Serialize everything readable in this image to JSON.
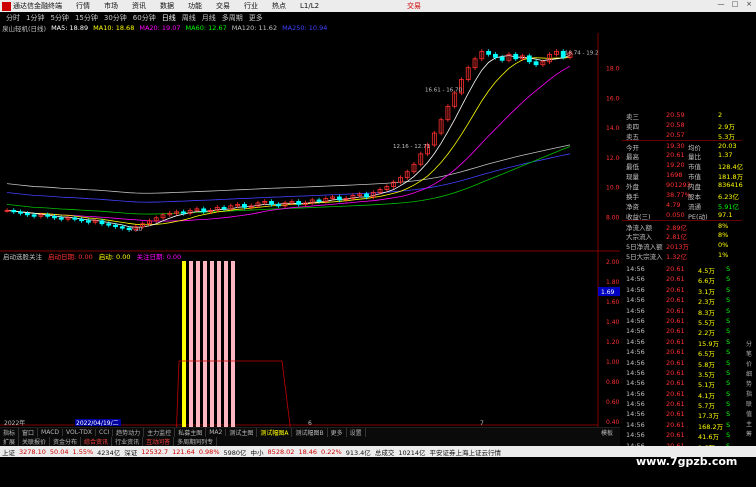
{
  "menubar": {
    "app_name": "通达信金融终端",
    "items": [
      "行情",
      "市场",
      "资讯",
      "数据",
      "功能",
      "交易",
      "行业",
      "热点",
      "L1/L2"
    ],
    "trade_label": "交易",
    "win_min": "—",
    "win_max": "□",
    "win_close": "×"
  },
  "periods": [
    "分时",
    "1分钟",
    "5分钟",
    "15分钟",
    "30分钟",
    "60分钟",
    "日线",
    "周线",
    "月线",
    "多周期",
    "更多"
  ],
  "active_period": "日线",
  "stock_label": "泉山轻机(日线)",
  "ma": [
    {
      "label": "MA5: 18.89",
      "color": "#ffffff"
    },
    {
      "label": "MA10: 18.68",
      "color": "#ffff00"
    },
    {
      "label": "MA20: 19.07",
      "color": "#ff00ff"
    },
    {
      "label": "MA60: 12.67",
      "color": "#00ff00"
    },
    {
      "label": "MA120: 11.62",
      "color": "#c0c0c0"
    },
    {
      "label": "MA250: 10.94",
      "color": "#4040ff"
    }
  ],
  "price_axis": [
    "18.00",
    "16.00",
    "14.00",
    "12.00",
    "10.00",
    "8.00"
  ],
  "ind_axis": [
    "2.00",
    "1.80",
    "1.60",
    "1.40",
    "1.20",
    "1.00",
    "0.80",
    "0.60",
    "0.40",
    "0.20"
  ],
  "indicator_title": {
    "name": "启动选股关注",
    "a": "启动日期: 0.00",
    "b": "启动: 0.00",
    "c": "关注日期: 0.00"
  },
  "annotations": {
    "low": "7.10",
    "mid1": "16.61 - 16.70",
    "mid2": "12.16 - 12.71",
    "hi": "18.74 - 19.2",
    "cursor_price": "1.69"
  },
  "dates": [
    "2022年",
    "2022/04/19/二",
    "6",
    "7"
  ],
  "tabs": [
    "指标",
    "窗口",
    "MACD",
    "VOL-TDX",
    "CCI",
    "趋势动力",
    "主力监控",
    "私募主图",
    "MA2",
    "测试主图",
    "测试幅图A",
    "测试幅图B",
    "更多",
    "设置"
  ],
  "tabs_active": "测试幅图A",
  "tabs_right": "模板",
  "tabs2": [
    "扩展",
    "关联报价",
    "资金分布",
    "综合资讯",
    "行业资讯",
    "互动问答",
    "多周期同列专"
  ],
  "quote_rows": [
    {
      "l": "卖三",
      "v": "20.59",
      "v2": "2"
    },
    {
      "l": "卖四",
      "v": "20.58",
      "v2": "2.9万"
    },
    {
      "l": "卖五",
      "v": "20.57",
      "v2": "5.3万"
    },
    {
      "l": "今开",
      "v": "19.30",
      "l2": "均价",
      "v2": "20.03"
    },
    {
      "l": "最高",
      "v": "20.61",
      "l2": "量比",
      "v2": "1.37"
    },
    {
      "l": "最低",
      "v": "19.20",
      "l2": "市值",
      "v2": "128.4亿"
    },
    {
      "l": "现量",
      "v": "1698",
      "l2": "市值",
      "v2": "181.8万"
    },
    {
      "l": "外盘",
      "v": "901293",
      "l2": "内盘",
      "v2": "836416"
    },
    {
      "l": "换手",
      "v": "38.77%",
      "l2": "股本",
      "v2": "6.23亿"
    },
    {
      "l": "净资",
      "v": "4.79",
      "l2": "流通",
      "v2": "5.91亿"
    },
    {
      "l": "收益(三)",
      "v": "0.050",
      "l2": "PE(动)",
      "v2": "97.1"
    },
    {
      "l": "净流入额",
      "v": "2.89亿",
      "v2": "8%"
    },
    {
      "l": "大宗流入",
      "v": "2.81亿",
      "v2": "8%"
    },
    {
      "l": "5日净流入额",
      "v": "2013万",
      "v2": "0%"
    },
    {
      "l": "5日大宗流入",
      "v": "1.32亿",
      "v2": "1%"
    }
  ],
  "ticks": [
    {
      "t": "14:56",
      "p": "20.61",
      "v": "4.5万",
      "s": "S"
    },
    {
      "t": "14:56",
      "p": "20.61",
      "v": "6.6万",
      "s": "S"
    },
    {
      "t": "14:56",
      "p": "20.61",
      "v": "3.1万",
      "s": "S"
    },
    {
      "t": "14:56",
      "p": "20.61",
      "v": "2.3万",
      "s": "S"
    },
    {
      "t": "14:56",
      "p": "20.61",
      "v": "8.3万",
      "s": "S"
    },
    {
      "t": "14:56",
      "p": "20.61",
      "v": "5.5万",
      "s": "S"
    },
    {
      "t": "14:56",
      "p": "20.61",
      "v": "2.2万",
      "s": "S"
    },
    {
      "t": "14:56",
      "p": "20.61",
      "v": "15.9万",
      "s": "S"
    },
    {
      "t": "14:56",
      "p": "20.61",
      "v": "6.5万",
      "s": "S"
    },
    {
      "t": "14:56",
      "p": "20.61",
      "v": "5.8万",
      "s": "S"
    },
    {
      "t": "14:56",
      "p": "20.61",
      "v": "3.5万",
      "s": "S"
    },
    {
      "t": "14:56",
      "p": "20.61",
      "v": "5.1万",
      "s": "S"
    },
    {
      "t": "14:56",
      "p": "20.61",
      "v": "4.1万",
      "s": "S"
    },
    {
      "t": "14:56",
      "p": "20.61",
      "v": "5.7万",
      "s": "S"
    },
    {
      "t": "14:56",
      "p": "20.61",
      "v": "17.3万",
      "s": "S"
    },
    {
      "t": "14:56",
      "p": "20.61",
      "v": "168.2万",
      "s": "S"
    },
    {
      "t": "14:56",
      "p": "20.61",
      "v": "41.6万",
      "s": "S"
    },
    {
      "t": "14:56",
      "p": "20.61",
      "v": "1.6万",
      "s": "S"
    }
  ],
  "vtabs": [
    "分",
    "笔",
    "价",
    "细",
    "势",
    "指",
    "联",
    "值",
    "主",
    "筹"
  ],
  "status": {
    "sh_label": "上证",
    "sh_val": "3278.10",
    "sh_chg": "50.04",
    "sh_pct": "1.55%",
    "sh_amt": "4234亿",
    "sz_label": "深证",
    "sz_val": "12532.7",
    "sz_chg": "121.64",
    "sz_pct": "0.98%",
    "sz_amt": "5980亿",
    "zx_label": "中小",
    "zx_val": "8528.02",
    "zx_chg": "18.46",
    "zx_pct": "0.22%",
    "zx_amt": "913.4亿",
    "total_label": "总成交",
    "total_val": "10214亿",
    "broker": "平安证券上海上证云行情"
  },
  "watermark": "www.7gpzb.com",
  "chart_data": {
    "type": "candlestick",
    "price_range": [
      6,
      20
    ],
    "closes": [
      8.4,
      8.3,
      8.2,
      8.1,
      8.0,
      8.1,
      8.0,
      7.9,
      7.8,
      7.9,
      7.8,
      7.7,
      7.6,
      7.7,
      7.5,
      7.4,
      7.3,
      7.2,
      7.1,
      7.3,
      7.5,
      7.7,
      7.9,
      8.1,
      8.2,
      8.3,
      8.2,
      8.4,
      8.5,
      8.3,
      8.4,
      8.6,
      8.5,
      8.7,
      8.8,
      8.6,
      8.7,
      8.9,
      9.0,
      8.8,
      8.7,
      8.9,
      9.0,
      8.8,
      8.9,
      9.1,
      9.0,
      9.2,
      9.3,
      9.1,
      9.2,
      9.4,
      9.5,
      9.3,
      9.6,
      9.8,
      10.0,
      10.3,
      10.6,
      11.0,
      11.5,
      12.2,
      12.8,
      13.6,
      14.5,
      15.4,
      16.3,
      17.2,
      18.0,
      18.6,
      19.1,
      18.9,
      18.7,
      18.5,
      18.9,
      18.6,
      18.8,
      18.4,
      18.2,
      18.4,
      18.9,
      19.1,
      18.7,
      19.0
    ],
    "indicator": {
      "yellow_bar_index": 0,
      "pink_bar_count": 7,
      "step_level": 1.0
    }
  }
}
